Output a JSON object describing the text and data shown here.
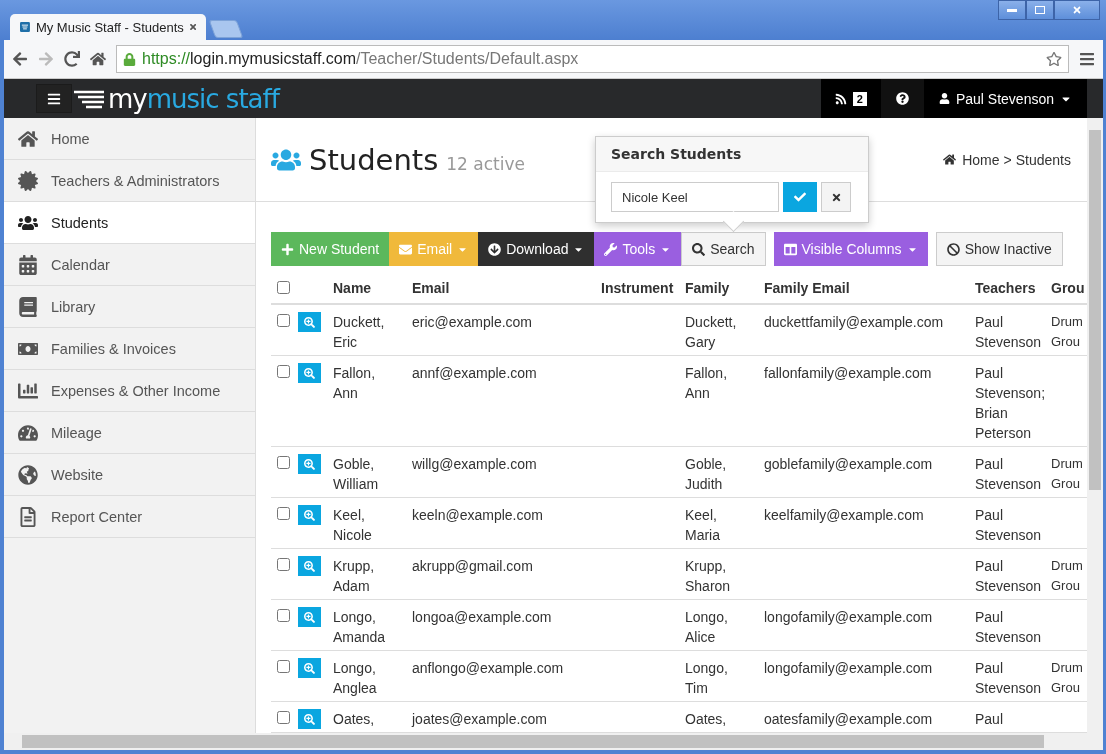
{
  "browser": {
    "tab_title": "My Music Staff - Students",
    "url": {
      "scheme": "https://",
      "host": "login.mymusicstaff.com",
      "path": "/Teacher/Students/Default.aspx"
    }
  },
  "navbar": {
    "logo": {
      "text": "my",
      "accent": "music staff"
    },
    "feed_count": "2",
    "user": "Paul Stevenson"
  },
  "sidebar": {
    "items": [
      {
        "label": "Home",
        "selected": false
      },
      {
        "label": "Teachers & Administrators",
        "selected": false
      },
      {
        "label": "Students",
        "selected": true
      },
      {
        "label": "Calendar",
        "selected": false
      },
      {
        "label": "Library",
        "selected": false
      },
      {
        "label": "Families & Invoices",
        "selected": false
      },
      {
        "label": "Expenses & Other Income",
        "selected": false
      },
      {
        "label": "Mileage",
        "selected": false
      },
      {
        "label": "Website",
        "selected": false
      },
      {
        "label": "Report Center",
        "selected": false
      }
    ]
  },
  "page": {
    "title": "Students",
    "subtitle": "12 active",
    "breadcrumb": {
      "home": "Home",
      "separator": ">",
      "current": "Students"
    }
  },
  "search_popover": {
    "title": "Search Students",
    "value": "Nicole Keel"
  },
  "toolbar": {
    "groups": [
      [
        {
          "label": "New Student",
          "kind": "success",
          "caret": false
        },
        {
          "label": "Email",
          "kind": "warning",
          "caret": true
        },
        {
          "label": "Download",
          "kind": "dark",
          "caret": true
        },
        {
          "label": "Tools",
          "kind": "purple",
          "caret": true
        },
        {
          "label": "Search",
          "kind": "default",
          "caret": false
        }
      ],
      [
        {
          "label": "Visible Columns",
          "kind": "purple",
          "caret": true
        }
      ],
      [
        {
          "label": "Show Inactive",
          "kind": "default",
          "caret": false
        }
      ]
    ]
  },
  "table": {
    "select_all_checked": false,
    "columns": [
      "Name",
      "Email",
      "Instrument",
      "Family",
      "Family Email",
      "Teachers",
      "Grou"
    ],
    "rows": [
      {
        "checked": false,
        "name": "Duckett, Eric",
        "email": "eric@example.com",
        "family": "Duckett, Gary",
        "family_email": "duckettfamily@example.com",
        "teachers": "Paul Stevenson",
        "column_7": "Drum Grou"
      },
      {
        "checked": false,
        "name": "Fallon, Ann",
        "email": "annf@example.com",
        "family": "Fallon, Ann",
        "family_email": "fallonfamily@example.com",
        "teachers": "Paul Stevenson; Brian Peterson"
      },
      {
        "checked": false,
        "name": "Goble, William",
        "email": "willg@example.com",
        "family": "Goble, Judith",
        "family_email": "goblefamily@example.com",
        "teachers": "Paul Stevenson",
        "column_7": "Drum Grou"
      },
      {
        "checked": false,
        "name": "Keel, Nicole",
        "email": "keeln@example.com",
        "family": "Keel, Maria",
        "family_email": "keelfamily@example.com",
        "teachers": "Paul Stevenson"
      },
      {
        "checked": false,
        "name": "Krupp, Adam",
        "email": "akrupp@gmail.com",
        "family": "Krupp, Sharon",
        "teachers": "Paul Stevenson",
        "column_7": "Drum Grou"
      },
      {
        "checked": false,
        "name": "Longo, Amanda",
        "email": "longoa@example.com",
        "family": "Longo, Alice",
        "family_email": "longofamily@example.com",
        "teachers": "Paul Stevenson"
      },
      {
        "checked": false,
        "name": "Longo, Anglea",
        "email": "anflongo@example.com",
        "family": "Longo, Tim",
        "family_email": "longofamily@example.com",
        "teachers": "Paul Stevenson",
        "column_7": "Drum Grou"
      },
      {
        "checked": false,
        "name": "Oates,",
        "email": "joates@example.com",
        "family": "Oates,",
        "family_email": "oatesfamily@example.com",
        "teachers": "Paul"
      }
    ]
  }
}
